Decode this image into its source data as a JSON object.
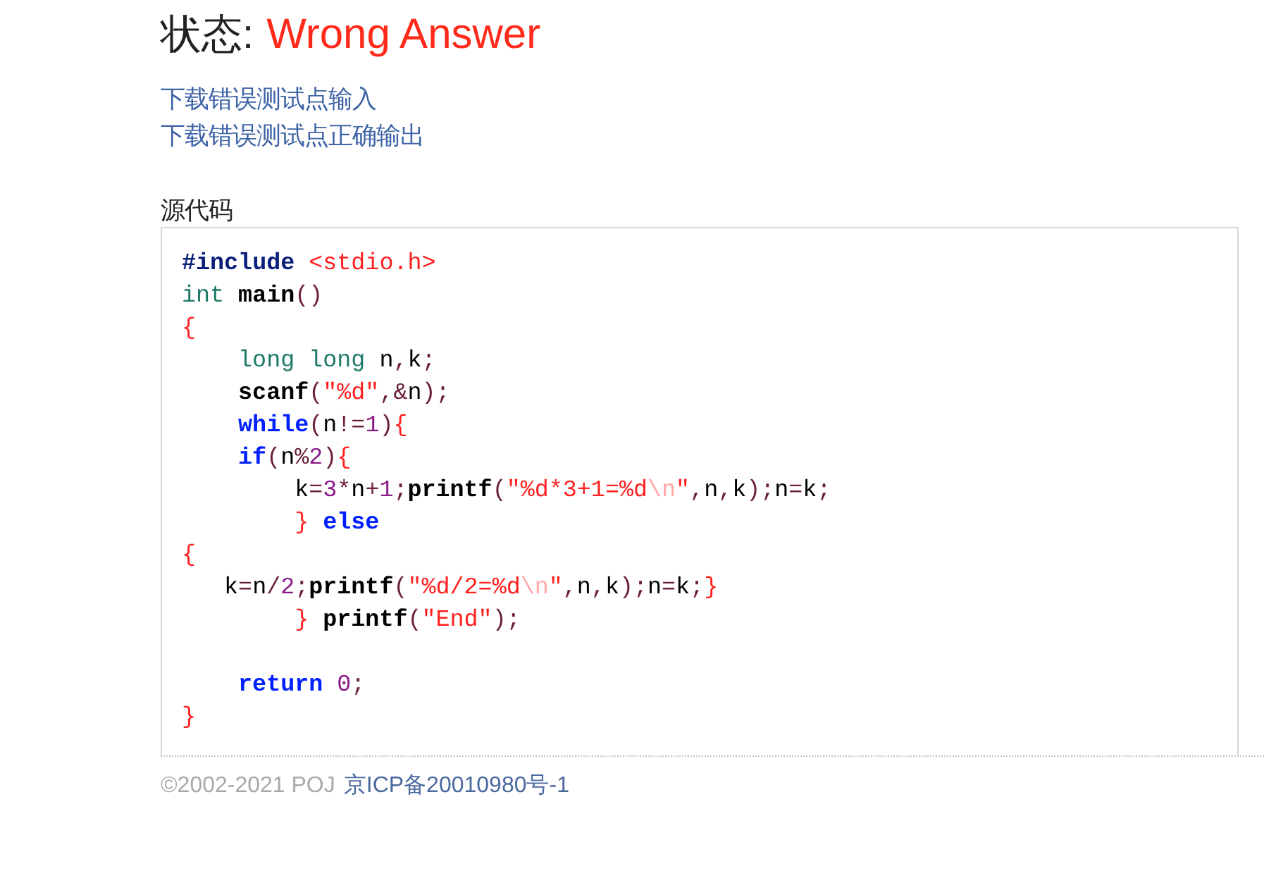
{
  "status": {
    "label": "状态:",
    "value": "Wrong Answer"
  },
  "links": [
    "下载错误测试点输入",
    "下载错误测试点正确输出"
  ],
  "source_code": {
    "title": "源代码",
    "lines": [
      {
        "kind": "flush",
        "tokens": [
          {
            "kind": "directive",
            "text": "#include"
          },
          {
            "kind": "string",
            "text": " <stdio.h>"
          }
        ]
      },
      {
        "kind": "flush",
        "tokens": [
          {
            "kind": "type",
            "text": "int"
          },
          {
            "kind": "func",
            "text": " main"
          },
          {
            "kind": "op",
            "text": "()"
          }
        ]
      },
      {
        "kind": "flush",
        "tokens": [
          {
            "kind": "brace",
            "text": "{"
          }
        ]
      },
      {
        "kind": "indented",
        "tokens": [
          {
            "kind": "type",
            "text": "long long"
          },
          {
            "kind": "plain",
            "text": " n"
          },
          {
            "kind": "op",
            "text": ","
          },
          {
            "kind": "plain",
            "text": "k"
          },
          {
            "kind": "op",
            "text": ";"
          }
        ]
      },
      {
        "kind": "indented",
        "tokens": [
          {
            "kind": "func",
            "text": "scanf"
          },
          {
            "kind": "op",
            "text": "("
          },
          {
            "kind": "string",
            "text": "\"%d\""
          },
          {
            "kind": "op",
            "text": ",&"
          },
          {
            "kind": "plain",
            "text": "n"
          },
          {
            "kind": "op",
            "text": ");"
          }
        ]
      },
      {
        "kind": "indented",
        "tokens": [
          {
            "kind": "keyword",
            "text": "while"
          },
          {
            "kind": "op",
            "text": "("
          },
          {
            "kind": "plain",
            "text": "n"
          },
          {
            "kind": "op",
            "text": "!="
          },
          {
            "kind": "number",
            "text": "1"
          },
          {
            "kind": "op",
            "text": ")"
          },
          {
            "kind": "brace",
            "text": "{"
          }
        ]
      },
      {
        "kind": "indented",
        "tokens": [
          {
            "kind": "keyword",
            "text": "if"
          },
          {
            "kind": "op",
            "text": "("
          },
          {
            "kind": "plain",
            "text": "n"
          },
          {
            "kind": "op",
            "text": "%"
          },
          {
            "kind": "number",
            "text": "2"
          },
          {
            "kind": "op",
            "text": ")"
          },
          {
            "kind": "brace",
            "text": "{"
          }
        ]
      },
      {
        "kind": "nested",
        "tokens": [
          {
            "kind": "plain",
            "text": "k"
          },
          {
            "kind": "op",
            "text": "="
          },
          {
            "kind": "number",
            "text": "3"
          },
          {
            "kind": "op",
            "text": "*"
          },
          {
            "kind": "plain",
            "text": "n"
          },
          {
            "kind": "op",
            "text": "+"
          },
          {
            "kind": "number",
            "text": "1"
          },
          {
            "kind": "op",
            "text": ";"
          },
          {
            "kind": "func",
            "text": "printf"
          },
          {
            "kind": "op",
            "text": "("
          },
          {
            "kind": "string",
            "text": "\"%d*3+1=%d"
          },
          {
            "kind": "escape",
            "text": "\\n"
          },
          {
            "kind": "string",
            "text": "\""
          },
          {
            "kind": "op",
            "text": ","
          },
          {
            "kind": "plain",
            "text": "n"
          },
          {
            "kind": "op",
            "text": ","
          },
          {
            "kind": "plain",
            "text": "k"
          },
          {
            "kind": "op",
            "text": ");"
          },
          {
            "kind": "plain",
            "text": "n"
          },
          {
            "kind": "op",
            "text": "="
          },
          {
            "kind": "plain",
            "text": "k"
          },
          {
            "kind": "op",
            "text": ";"
          }
        ]
      },
      {
        "kind": "nested",
        "tokens": [
          {
            "kind": "brace",
            "text": "}"
          },
          {
            "kind": "keyword",
            "text": " else"
          }
        ]
      },
      {
        "kind": "flush",
        "tokens": [
          {
            "kind": "brace",
            "text": "{"
          }
        ]
      },
      {
        "kind": "offset",
        "tokens": [
          {
            "kind": "plain",
            "text": "k"
          },
          {
            "kind": "op",
            "text": "="
          },
          {
            "kind": "plain",
            "text": "n"
          },
          {
            "kind": "op",
            "text": "/"
          },
          {
            "kind": "number",
            "text": "2"
          },
          {
            "kind": "op",
            "text": ";"
          },
          {
            "kind": "func",
            "text": "printf"
          },
          {
            "kind": "op",
            "text": "("
          },
          {
            "kind": "string",
            "text": "\"%d/2=%d"
          },
          {
            "kind": "escape",
            "text": "\\n"
          },
          {
            "kind": "string",
            "text": "\""
          },
          {
            "kind": "op",
            "text": ","
          },
          {
            "kind": "plain",
            "text": "n"
          },
          {
            "kind": "op",
            "text": ","
          },
          {
            "kind": "plain",
            "text": "k"
          },
          {
            "kind": "op",
            "text": ");"
          },
          {
            "kind": "plain",
            "text": "n"
          },
          {
            "kind": "op",
            "text": "="
          },
          {
            "kind": "plain",
            "text": "k"
          },
          {
            "kind": "op",
            "text": ";"
          },
          {
            "kind": "brace",
            "text": "}"
          }
        ]
      },
      {
        "kind": "nested",
        "tokens": [
          {
            "kind": "brace",
            "text": "}"
          },
          {
            "kind": "func",
            "text": " printf"
          },
          {
            "kind": "op",
            "text": "("
          },
          {
            "kind": "string",
            "text": "\"End\""
          },
          {
            "kind": "op",
            "text": ");"
          }
        ]
      },
      {
        "kind": "blank"
      },
      {
        "kind": "indented",
        "tokens": [
          {
            "kind": "keyword",
            "text": "return"
          },
          {
            "kind": "number",
            "text": " 0"
          },
          {
            "kind": "op",
            "text": ";"
          }
        ]
      },
      {
        "kind": "flush",
        "tokens": [
          {
            "kind": "brace",
            "text": "}"
          }
        ]
      }
    ]
  },
  "footer": {
    "copyright": "©2002-2021 POJ",
    "icp": "京ICP备20010980号-1"
  }
}
